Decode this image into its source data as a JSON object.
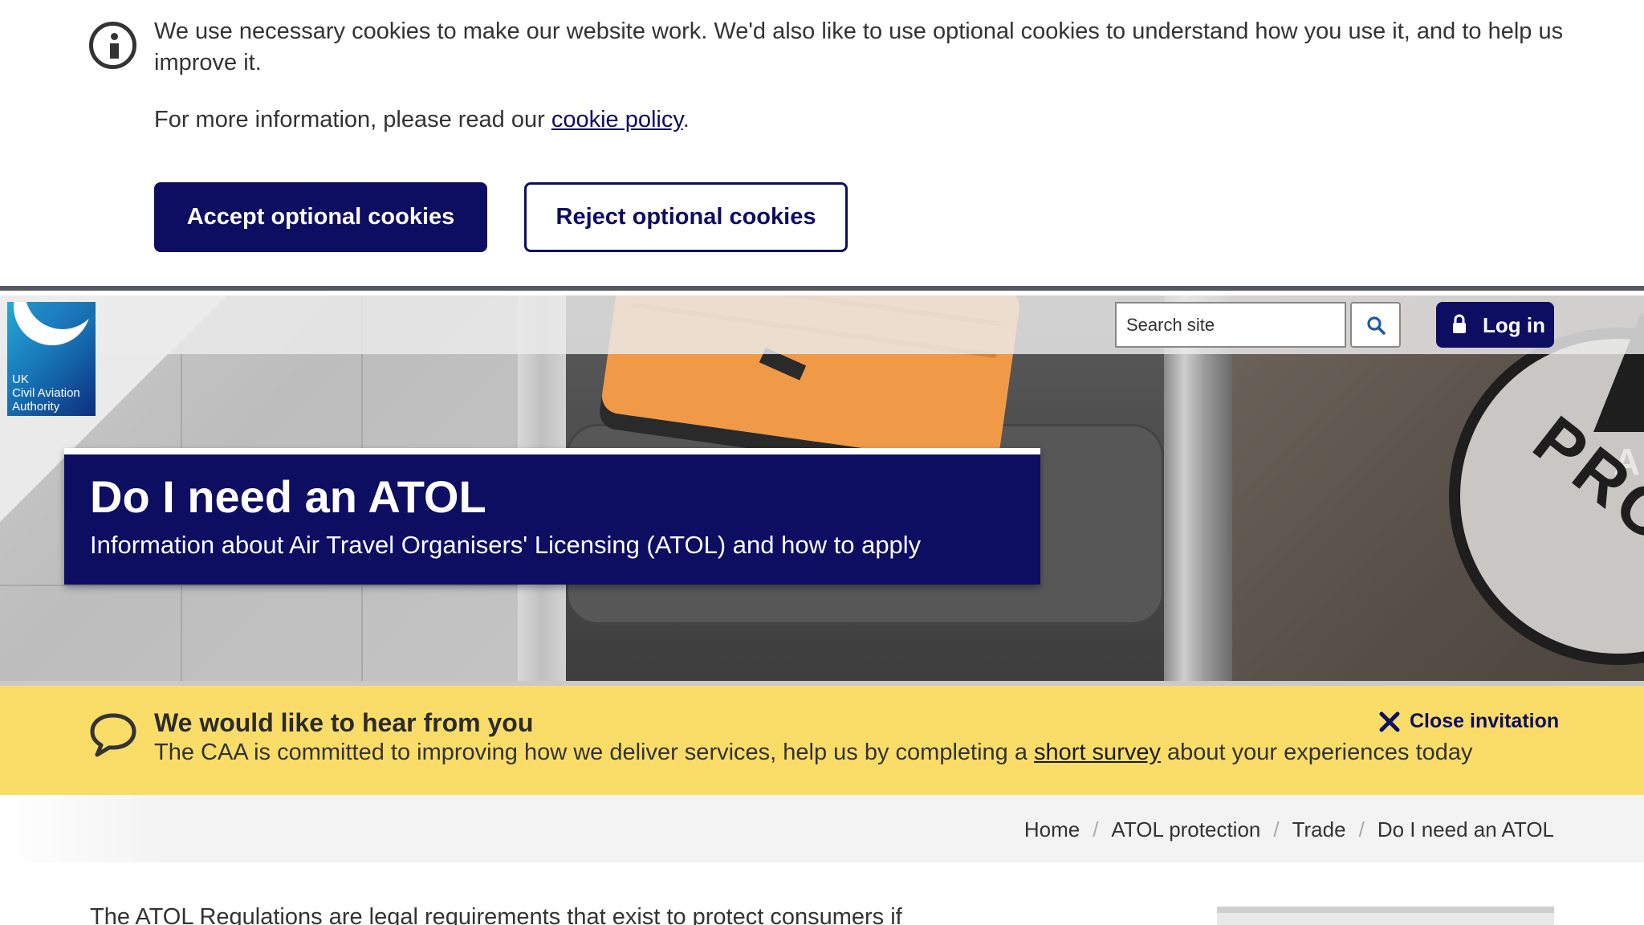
{
  "cookie_banner": {
    "message": "We use necessary cookies to make our website work. We'd also like to use optional cookies to understand how you use it, and to help us improve it.",
    "more_info_prefix": "For more information, please read our ",
    "policy_link": "cookie policy",
    "more_info_suffix": ".",
    "accept_label": "Accept optional cookies",
    "reject_label": "Reject optional cookies"
  },
  "header": {
    "logo_text": [
      "UK",
      "Civil Aviation",
      "Authority"
    ],
    "search_placeholder": "Search site",
    "login_label": "Log in"
  },
  "hero": {
    "title": "Do I need an ATOL",
    "subtitle": "Information about Air Travel Organisers' Licensing (ATOL) and how to apply",
    "badge_text": "PROT",
    "badge_letter": "A"
  },
  "survey": {
    "title": "We would like to hear from you",
    "text_prefix": "The CAA is committed to improving how we deliver services, help us by completing a ",
    "link": "short survey",
    "text_suffix": " about your experiences today",
    "close_label": "Close invitation"
  },
  "breadcrumb": {
    "items": [
      "Home",
      "ATOL protection",
      "Trade",
      "Do I need an ATOL"
    ]
  },
  "main": {
    "intro": "The ATOL Regulations are legal requirements that exist to protect consumers if"
  },
  "colors": {
    "navy": "#0d0d62",
    "survey_yellow": "#fadd69"
  }
}
